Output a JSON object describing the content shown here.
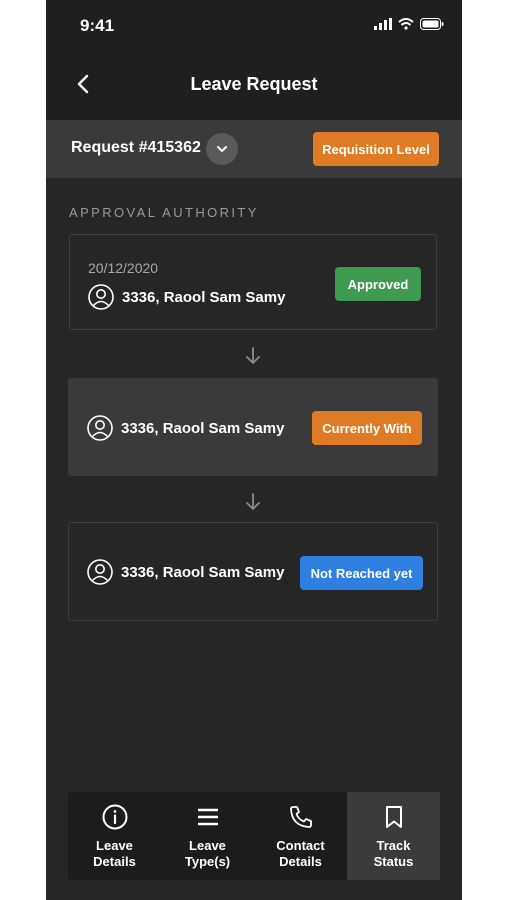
{
  "status_bar": {
    "time": "9:41"
  },
  "header": {
    "title": "Leave Request"
  },
  "request": {
    "title": "Request #415362",
    "level_badge": "Requisition Level"
  },
  "approval": {
    "section_label": "APPROVAL AUTHORITY",
    "cards": [
      {
        "date": "20/12/2020",
        "name": "3336, Raool Sam Samy",
        "status": "Approved"
      },
      {
        "name": "3336, Raool Sam Samy",
        "status": "Currently With"
      },
      {
        "name": "3336, Raool Sam Samy",
        "status": "Not Reached yet"
      }
    ]
  },
  "tabs": [
    {
      "label": "Leave\nDetails",
      "icon": "info-icon"
    },
    {
      "label": "Leave\nType(s)",
      "icon": "menu-icon"
    },
    {
      "label": "Contact\nDetails",
      "icon": "phone-icon"
    },
    {
      "label": "Track\nStatus",
      "icon": "bookmark-icon"
    }
  ],
  "colors": {
    "background": "#262626",
    "orange": "#e07b25",
    "green": "#3f9b4f",
    "blue": "#2f7fe0"
  }
}
